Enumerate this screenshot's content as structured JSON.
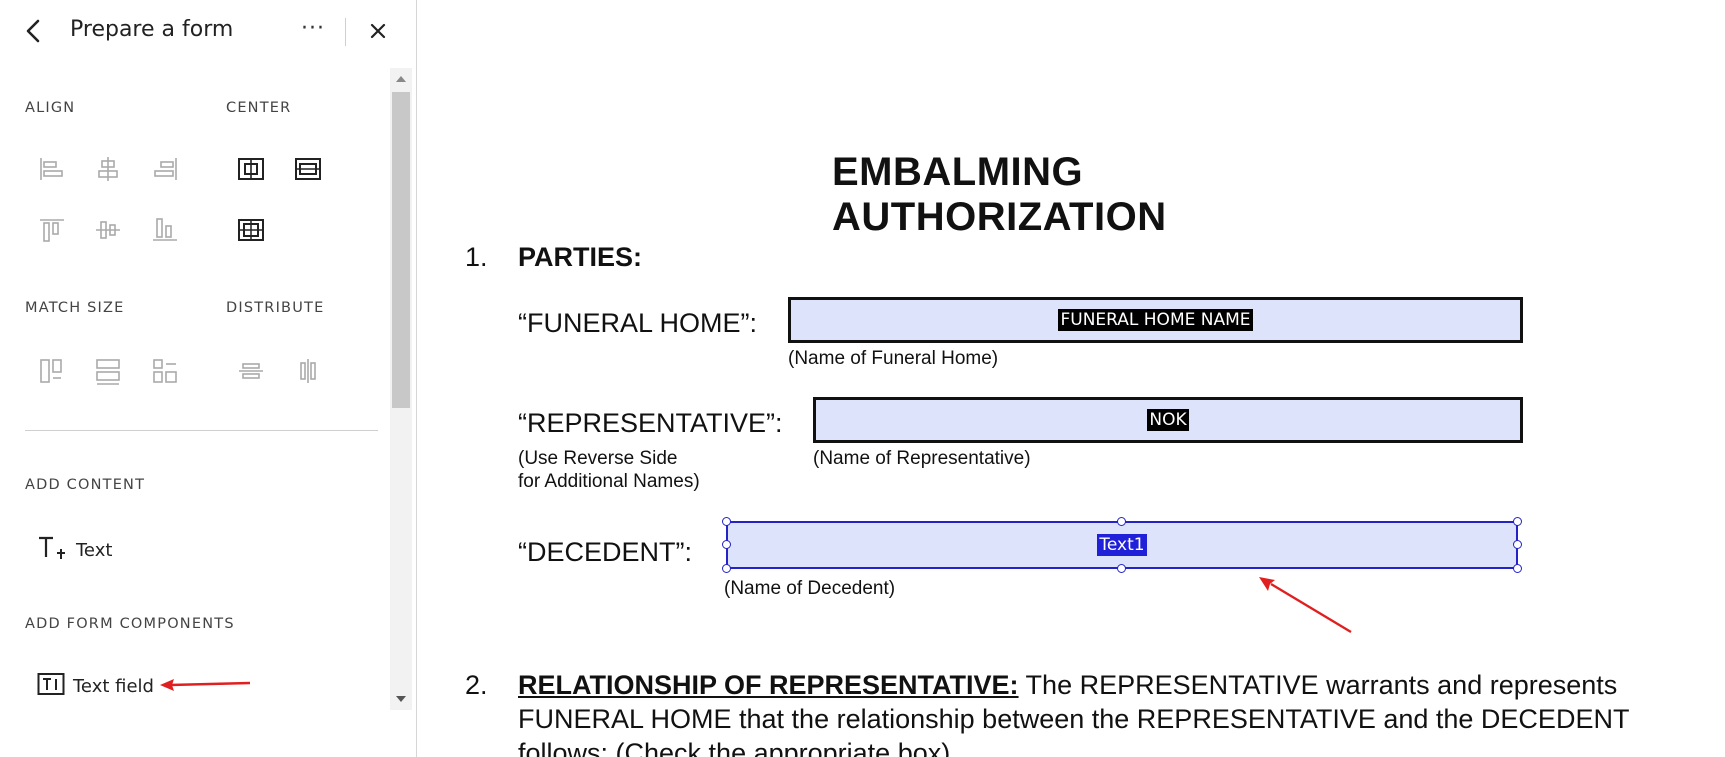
{
  "sidebar": {
    "title": "Prepare a form",
    "more_label": "···",
    "sections": {
      "align": "ALIGN",
      "center": "CENTER",
      "match_size": "MATCH SIZE",
      "distribute": "DISTRIBUTE",
      "add_content": "ADD CONTENT",
      "add_form_components": "ADD FORM COMPONENTS"
    },
    "add_content_items": [
      {
        "label": "Text",
        "icon": "add-text-icon"
      }
    ],
    "form_component_items": [
      {
        "label": "Text field",
        "icon": "text-field-icon"
      }
    ]
  },
  "document": {
    "title": "EMBALMING AUTHORIZATION",
    "section1": {
      "number": "1.",
      "heading": "PARTIES:"
    },
    "funeral_home": {
      "label": "“FUNERAL HOME”:",
      "field_value": "FUNERAL HOME NAME",
      "caption": "(Name of Funeral Home)"
    },
    "representative": {
      "label": "“REPRESENTATIVE”:",
      "field_value": "NOK",
      "caption": "(Name of Representative)",
      "note_line1": "(Use Reverse Side",
      "note_line2": "for Additional Names)"
    },
    "decedent": {
      "label": "“DECEDENT”:",
      "field_value": "Text1",
      "caption": "(Name of Decedent)"
    },
    "section2": {
      "number": "2.",
      "heading": "RELATIONSHIP OF REPRESENTATIVE:",
      "line1": " The REPRESENTATIVE  warrants and represents",
      "line2": "FUNERAL HOME that the relationship between the REPRESENTATIVE and the DECEDENT",
      "line3": "follows: (Check the appropriate box)"
    }
  },
  "colors": {
    "field_fill": "#dde3fb",
    "selection_blue": "#2323c8",
    "annotation_arrow": "#e02020"
  }
}
